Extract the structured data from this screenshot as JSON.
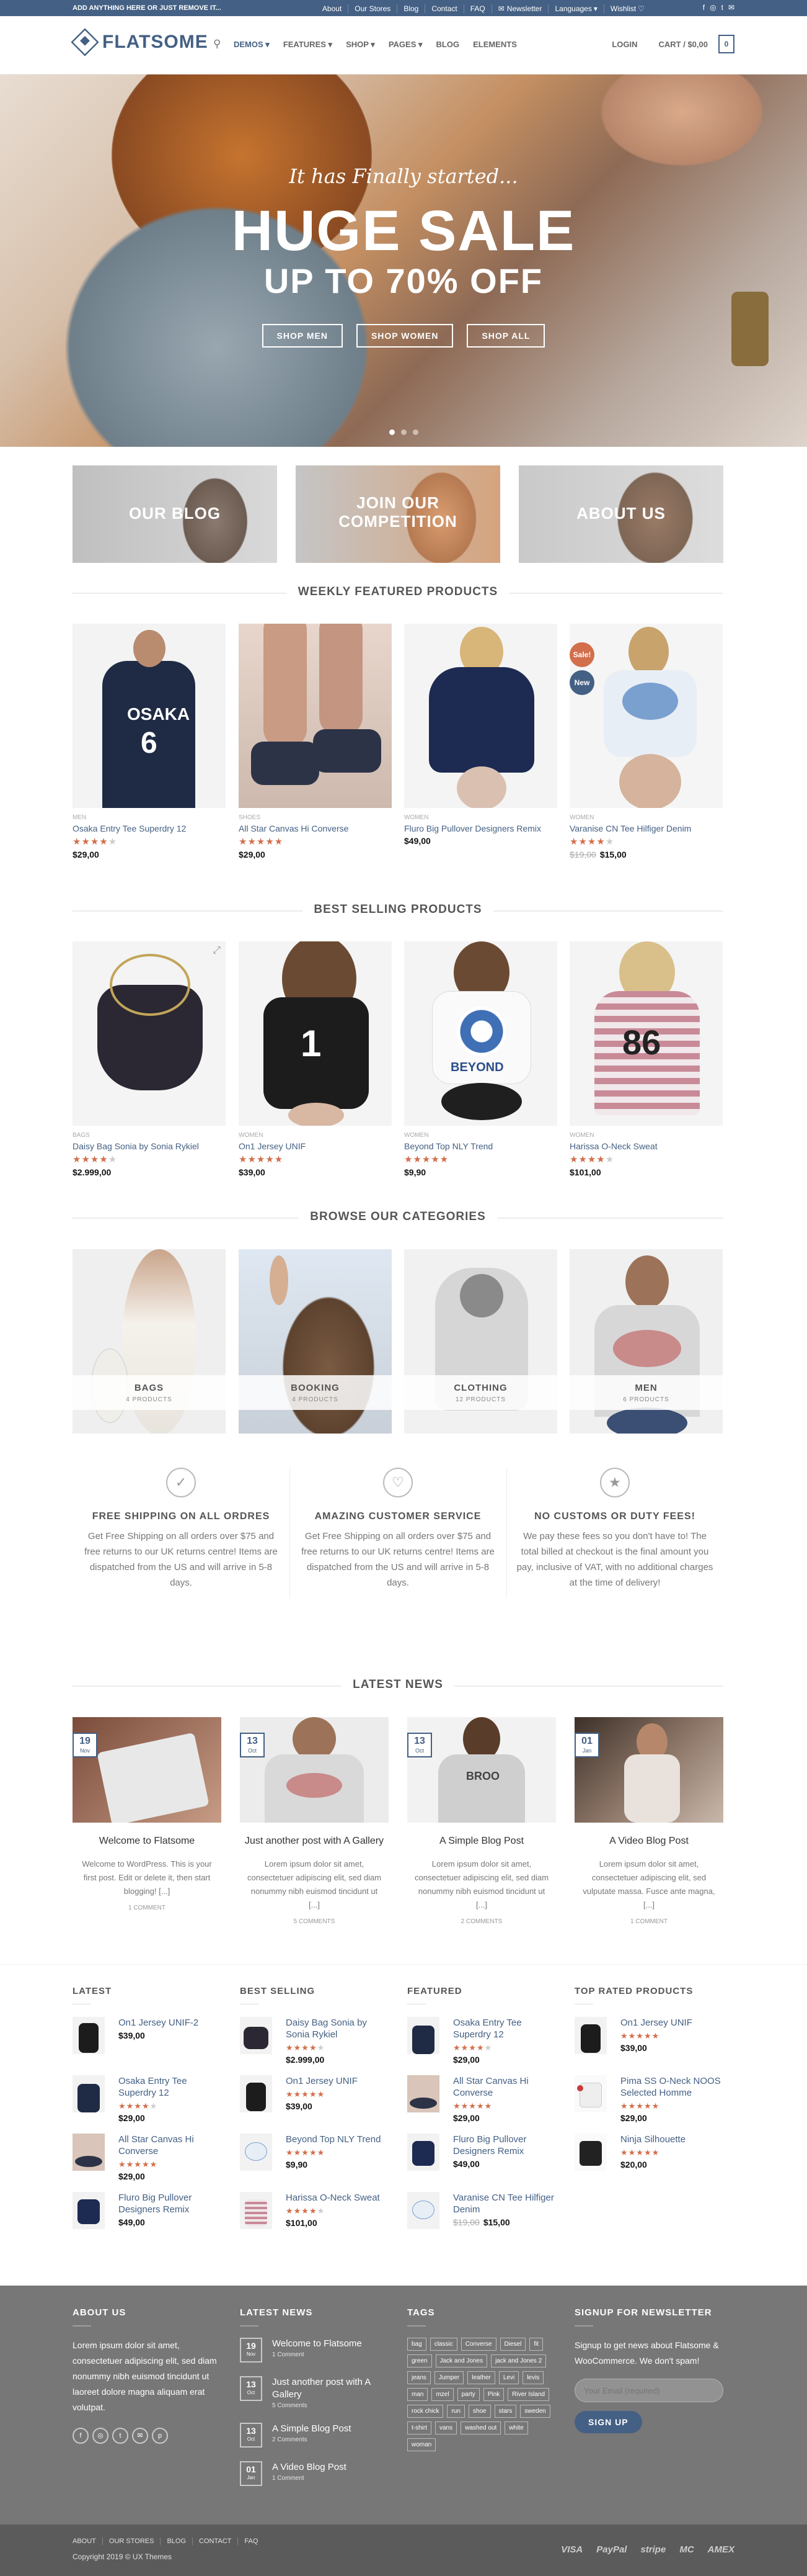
{
  "topbar": {
    "message": "ADD ANYTHING HERE OR JUST REMOVE IT...",
    "nav": [
      "About",
      "Our Stores",
      "Blog",
      "Contact",
      "FAQ",
      "Newsletter",
      "Languages",
      "Wishlist"
    ]
  },
  "header": {
    "logo": "FLATSOME",
    "nav": [
      "DEMOS",
      "FEATURES",
      "SHOP",
      "PAGES",
      "BLOG",
      "ELEMENTS"
    ],
    "login": "LOGIN",
    "cart": "CART / $0,00",
    "cart_count": "0"
  },
  "hero": {
    "pretitle": "It has Finally started...",
    "title": "HUGE SALE",
    "subtitle": "UP TO 70% OFF",
    "buttons": [
      "SHOP MEN",
      "SHOP WOMEN",
      "SHOP ALL"
    ]
  },
  "banners": [
    "OUR BLOG",
    "JOIN OUR COMPETITION",
    "ABOUT US"
  ],
  "sections": {
    "featured": "WEEKLY FEATURED PRODUCTS",
    "best": "BEST SELLING PRODUCTS",
    "categories": "BROWSE OUR CATEGORIES",
    "news": "LATEST NEWS"
  },
  "featured_products": [
    {
      "cat": "MEN",
      "name": "Osaka Entry Tee Superdry 12",
      "price": "$29,00",
      "old": "",
      "stars": 4
    },
    {
      "cat": "SHOES",
      "name": "All Star Canvas Hi Converse",
      "price": "$29,00",
      "old": "",
      "stars": 5
    },
    {
      "cat": "WOMEN",
      "name": "Fluro Big Pullover Designers Remix",
      "price": "$49,00",
      "old": "",
      "stars": 0
    },
    {
      "cat": "WOMEN",
      "name": "Varanise CN Tee Hilfiger Denim",
      "price": "$15,00",
      "old": "$19,00",
      "stars": 4,
      "badges": [
        "Sale!",
        "New"
      ]
    }
  ],
  "best_products": [
    {
      "cat": "BAGS",
      "name": "Daisy Bag Sonia by Sonia Rykiel",
      "price": "$2.999,00",
      "stars": 4
    },
    {
      "cat": "WOMEN",
      "name": "On1 Jersey UNIF",
      "price": "$39,00",
      "stars": 5
    },
    {
      "cat": "WOMEN",
      "name": "Beyond Top NLY Trend",
      "price": "$9,90",
      "stars": 5
    },
    {
      "cat": "WOMEN",
      "name": "Harissa O-Neck Sweat",
      "price": "$101,00",
      "stars": 4
    }
  ],
  "categories": [
    {
      "name": "BAGS",
      "count": "4 PRODUCTS"
    },
    {
      "name": "BOOKING",
      "count": "4 PRODUCTS"
    },
    {
      "name": "CLOTHING",
      "count": "12 PRODUCTS"
    },
    {
      "name": "MEN",
      "count": "6 PRODUCTS"
    }
  ],
  "features": [
    {
      "title": "FREE SHIPPING ON ALL ORDRES",
      "text": "Get Free Shipping on all orders over $75 and free returns to our UK returns centre! Items are dispatched from the US and will arrive in 5-8 days."
    },
    {
      "title": "AMAZING CUSTOMER SERVICE",
      "text": "Get Free Shipping on all orders over $75 and free returns to our UK returns centre! Items are dispatched from the US and will arrive in 5-8 days."
    },
    {
      "title": "NO CUSTOMS OR DUTY FEES!",
      "text": "We pay these fees so you don't have to! The total billed at checkout is the final amount you pay, inclusive of VAT, with no additional charges at the time of delivery!"
    }
  ],
  "posts": [
    {
      "day": "19",
      "mon": "Nov",
      "title": "Welcome to Flatsome",
      "excerpt": "Welcome to WordPress. This is your first post. Edit or delete it, then start blogging! [...]",
      "comments": "1 COMMENT"
    },
    {
      "day": "13",
      "mon": "Oct",
      "title": "Just another post with A Gallery",
      "excerpt": "Lorem ipsum dolor sit amet, consectetuer adipiscing elit, sed diam nonummy nibh euismod tincidunt ut [...]",
      "comments": "5 COMMENTS"
    },
    {
      "day": "13",
      "mon": "Oct",
      "title": "A Simple Blog Post",
      "excerpt": "Lorem ipsum dolor sit amet, consectetuer adipiscing elit, sed diam nonummy nibh euismod tincidunt ut [...]",
      "comments": "2 COMMENTS"
    },
    {
      "day": "01",
      "mon": "Jan",
      "title": "A Video Blog Post",
      "excerpt": "Lorem ipsum dolor sit amet, consectetuer adipiscing elit, sed vulputate massa. Fusce ante magna, [...]",
      "comments": "1 COMMENT"
    }
  ],
  "widgets": [
    {
      "title": "LATEST",
      "items": [
        {
          "name": "On1 Jersey UNIF-2",
          "price": "$39,00",
          "stars": 0
        },
        {
          "name": "Osaka Entry Tee Superdry 12",
          "price": "$29,00",
          "stars": 4
        },
        {
          "name": "All Star Canvas Hi Converse",
          "price": "$29,00",
          "stars": 5
        },
        {
          "name": "Fluro Big Pullover Designers Remix",
          "price": "$49,00",
          "stars": 0
        }
      ]
    },
    {
      "title": "BEST SELLING",
      "items": [
        {
          "name": "Daisy Bag Sonia by Sonia Rykiel",
          "price": "$2.999,00",
          "stars": 4
        },
        {
          "name": "On1 Jersey UNIF",
          "price": "$39,00",
          "stars": 5
        },
        {
          "name": "Beyond Top NLY Trend",
          "price": "$9,90",
          "stars": 5
        },
        {
          "name": "Harissa O-Neck Sweat",
          "price": "$101,00",
          "stars": 4
        }
      ]
    },
    {
      "title": "FEATURED",
      "items": [
        {
          "name": "Osaka Entry Tee Superdry 12",
          "price": "$29,00",
          "stars": 4
        },
        {
          "name": "All Star Canvas Hi Converse",
          "price": "$29,00",
          "stars": 5
        },
        {
          "name": "Fluro Big Pullover Designers Remix",
          "price": "$49,00",
          "stars": 0
        },
        {
          "name": "Varanise CN Tee Hilfiger Denim",
          "price": "$15,00",
          "old": "$19,00",
          "stars": 0
        }
      ]
    },
    {
      "title": "TOP RATED PRODUCTS",
      "items": [
        {
          "name": "On1 Jersey UNIF",
          "price": "$39,00",
          "stars": 5
        },
        {
          "name": "Pima SS O-Neck NOOS Selected Homme",
          "price": "$29,00",
          "stars": 5
        },
        {
          "name": "Ninja Silhouette",
          "price": "$20,00",
          "stars": 5
        }
      ]
    }
  ],
  "footer": {
    "about_title": "ABOUT US",
    "about_text": "Lorem ipsum dolor sit amet, consectetuer adipiscing elit, sed diam nonummy nibh euismod tincidunt ut laoreet dolore magna aliquam erat volutpat.",
    "news_title": "LATEST NEWS",
    "news": [
      {
        "day": "19",
        "mon": "Nov",
        "title": "Welcome to Flatsome",
        "comments": "1 Comment"
      },
      {
        "day": "13",
        "mon": "Oct",
        "title": "Just another post with A Gallery",
        "comments": "5 Comments"
      },
      {
        "day": "13",
        "mon": "Oct",
        "title": "A Simple Blog Post",
        "comments": "2 Comments"
      },
      {
        "day": "01",
        "mon": "Jan",
        "title": "A Video Blog Post",
        "comments": "1 Comment"
      }
    ],
    "tags_title": "TAGS",
    "tags": [
      "bag",
      "classic",
      "Converse",
      "Diesel",
      "fit",
      "green",
      "Jack and Jones",
      "jack and Jones 2",
      "jeans",
      "Jumper",
      "leather",
      "Levi",
      "levis",
      "man",
      "mzel",
      "party",
      "Pink",
      "River Island",
      "rock chick",
      "run",
      "shoe",
      "stars",
      "sweden",
      "t-shirt",
      "vans",
      "washed out",
      "white",
      "woman"
    ],
    "signup_title": "SIGNUP FOR NEWSLETTER",
    "signup_text": "Signup to get news about Flatsome & WooCommerce. We don't spam!",
    "email_placeholder": "Your Email (required)",
    "signup_button": "SIGN UP"
  },
  "absolute_footer": {
    "nav": [
      "ABOUT",
      "OUR STORES",
      "BLOG",
      "CONTACT",
      "FAQ"
    ],
    "copyright": "Copyright 2019 © UX Themes",
    "payments": [
      "VISA",
      "PayPal",
      "stripe",
      "MC",
      "AMEX"
    ]
  },
  "colors": {
    "primary": "#446084",
    "accent": "#d26e4b",
    "footer": "#777777"
  }
}
